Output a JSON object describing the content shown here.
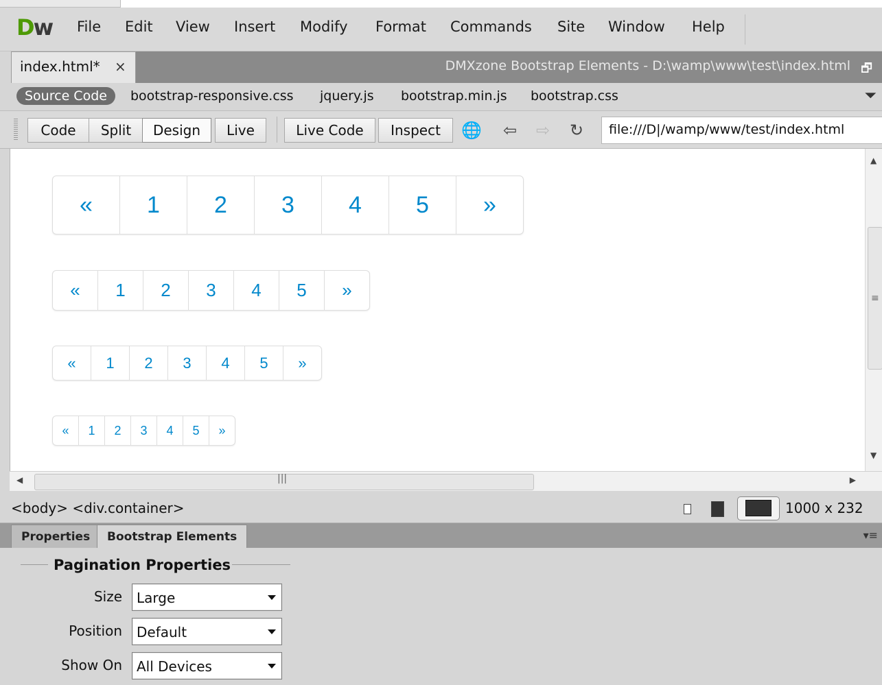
{
  "app": {
    "logo_d": "D",
    "logo_w": "w"
  },
  "menu": [
    "File",
    "Edit",
    "View",
    "Insert",
    "Modify",
    "Format",
    "Commands",
    "Site",
    "Window",
    "Help"
  ],
  "document_tab": {
    "label": "index.html*",
    "close": "×"
  },
  "window_title": "DMXzone Bootstrap Elements - D:\\wamp\\www\\test\\index.html",
  "related_files": {
    "source_code": "Source Code",
    "files": [
      "bootstrap-responsive.css",
      "jquery.js",
      "bootstrap.min.js",
      "bootstrap.css"
    ]
  },
  "toolbar": {
    "code": "Code",
    "split": "Split",
    "design": "Design",
    "live": "Live",
    "live_code": "Live Code",
    "inspect": "Inspect",
    "url": "file:///D|/wamp/www/test/index.html"
  },
  "pagination_items": [
    "«",
    "1",
    "2",
    "3",
    "4",
    "5",
    "»"
  ],
  "status": {
    "tag_selector": "<body> <div.container>",
    "window_size": "1000 x 232"
  },
  "panel_tabs": {
    "properties": "Properties",
    "bootstrap_elements": "Bootstrap Elements"
  },
  "pagination_properties": {
    "title": "Pagination Properties",
    "size_label": "Size",
    "size_value": "Large",
    "position_label": "Position",
    "position_value": "Default",
    "show_on_label": "Show On",
    "show_on_value": "All Devices"
  },
  "colors": {
    "link": "#0088cc",
    "logo_green": "#4e9a06"
  }
}
